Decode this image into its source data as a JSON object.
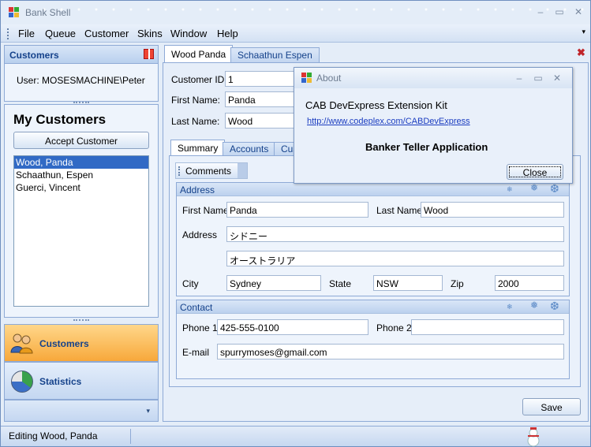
{
  "window": {
    "title": "Bank Shell",
    "minimize": "–",
    "maximize": "▭",
    "close": "✕"
  },
  "menu": [
    "File",
    "Queue",
    "Customer",
    "Skins",
    "Window",
    "Help"
  ],
  "menu_overflow": "▾",
  "customers_panel": {
    "title": "Customers",
    "user_label": "User:  MOSESMACHINE\\Peter",
    "heading": "My Customers",
    "accept_button": "Accept Customer",
    "list": [
      "Wood, Panda",
      "Schaathun, Espen",
      "Guerci, Vincent"
    ],
    "selected_index": 0
  },
  "nav": {
    "customers_label": "Customers",
    "statistics_label": "Statistics",
    "more": "▾"
  },
  "doc_tabs": [
    "Wood Panda",
    "Schaathun Espen"
  ],
  "form": {
    "customer_id_label": "Customer ID:",
    "customer_id": "1",
    "first_name_label": "First Name:",
    "first_name": "Panda",
    "last_name_label": "Last Name:",
    "last_name": "Wood"
  },
  "sub_tabs": [
    "Summary",
    "Accounts",
    "Cus"
  ],
  "comments_label": "Comments",
  "address": {
    "title": "Address",
    "first_name_label": "First Name",
    "first_name": "Panda",
    "last_name_label": "Last Name",
    "last_name": "Wood",
    "address_label": "Address",
    "line1": "シドニー",
    "line2": "オーストラリア",
    "city_label": "City",
    "city": "Sydney",
    "state_label": "State",
    "state": "NSW",
    "zip_label": "Zip",
    "zip": "2000"
  },
  "contact": {
    "title": "Contact",
    "phone1_label": "Phone 1",
    "phone1": "425-555-0100",
    "phone2_label": "Phone 2",
    "phone2": "",
    "email_label": "E-mail",
    "email": "spurrymoses@gmail.com"
  },
  "save_button": "Save",
  "status": "Editing Wood, Panda",
  "about": {
    "title": "About",
    "line1": "CAB DevExpress Extension Kit",
    "link": "http://www.codeplex.com/CABDevExpress",
    "app_name": "Banker Teller Application",
    "close_button": "Close"
  },
  "colors": {
    "accent": "#15428b",
    "selection": "#316ac5",
    "active_nav": "#f7a83b"
  }
}
